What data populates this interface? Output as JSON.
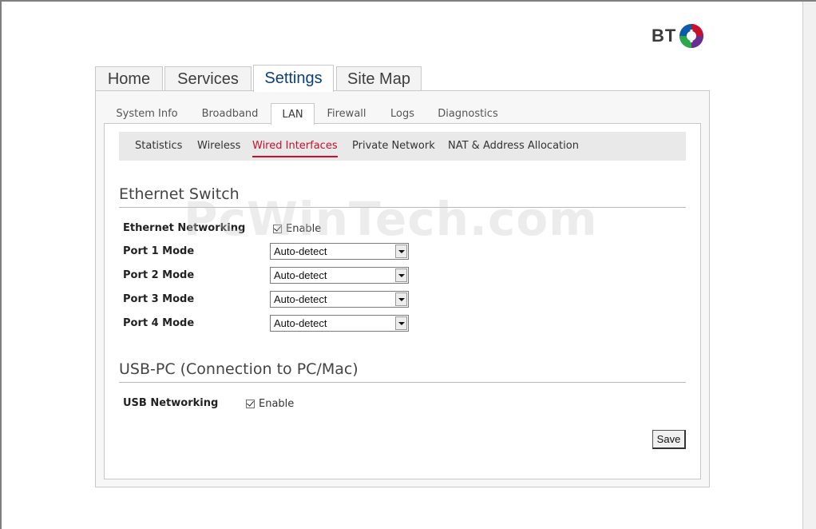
{
  "brand": {
    "logo_text": "BT",
    "colors": {
      "red": "#c8102e",
      "blue": "#0b5ca8",
      "purple": "#6a2c91"
    }
  },
  "main_tabs": [
    {
      "label": "Home"
    },
    {
      "label": "Services"
    },
    {
      "label": "Settings",
      "active": true
    },
    {
      "label": "Site Map"
    }
  ],
  "sub_tabs": [
    {
      "label": "System Info"
    },
    {
      "label": "Broadband"
    },
    {
      "label": "LAN",
      "active": true
    },
    {
      "label": "Firewall"
    },
    {
      "label": "Logs"
    },
    {
      "label": "Diagnostics"
    }
  ],
  "sub_nav": [
    {
      "label": "Statistics"
    },
    {
      "label": "Wireless"
    },
    {
      "label": "Wired Interfaces",
      "active": true
    },
    {
      "label": "Private Network"
    },
    {
      "label": "NAT & Address Allocation"
    }
  ],
  "watermark": "PcWinTech.com",
  "ethernet": {
    "title": "Ethernet Switch",
    "networking_label": "Ethernet Networking",
    "networking_enable": "Enable",
    "networking_checked": true,
    "ports": [
      {
        "label": "Port 1 Mode",
        "value": "Auto-detect"
      },
      {
        "label": "Port 2 Mode",
        "value": "Auto-detect"
      },
      {
        "label": "Port 3 Mode",
        "value": "Auto-detect"
      },
      {
        "label": "Port 4 Mode",
        "value": "Auto-detect"
      }
    ]
  },
  "usb": {
    "title": "USB-PC (Connection to PC/Mac)",
    "networking_label": "USB Networking",
    "networking_enable": "Enable",
    "networking_checked": true
  },
  "save_label": "Save"
}
